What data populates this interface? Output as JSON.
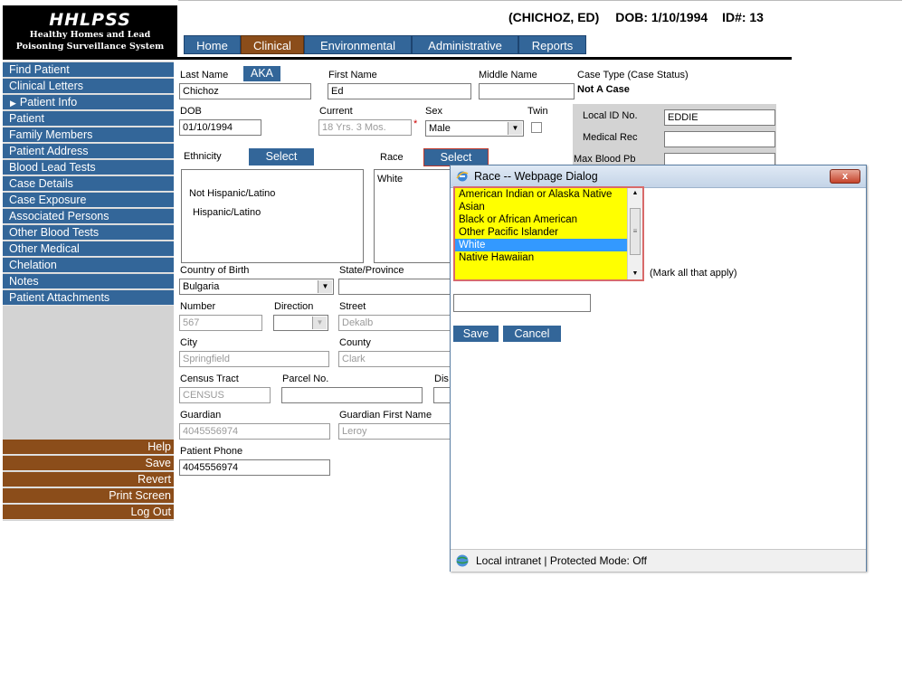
{
  "logo": {
    "title": "HHLPSS",
    "line1": "Healthy Homes and Lead",
    "line2": "Poisoning Surveillance System"
  },
  "patient_header": {
    "name": "(CHICHOZ, ED)",
    "dob": "DOB: 1/10/1994",
    "id": "ID#: 13"
  },
  "tabs": [
    {
      "label": "Home",
      "active": false
    },
    {
      "label": "Clinical",
      "active": true
    },
    {
      "label": "Environmental",
      "active": false
    },
    {
      "label": "Administrative",
      "active": false
    },
    {
      "label": "Reports",
      "active": false
    }
  ],
  "sidebar": {
    "nav": [
      "Find Patient",
      "Clinical Letters",
      "Patient Info",
      "Patient",
      "Family Members",
      "Patient Address",
      "Blood Lead Tests",
      "Case Details",
      "Case Exposure",
      "Associated Persons",
      "Other Blood Tests",
      "Other Medical",
      "Chelation",
      "Notes",
      "Patient Attachments"
    ],
    "current_item": "Patient Info",
    "actions": [
      "Help",
      "Save",
      "Revert",
      "Print Screen",
      "Log Out"
    ]
  },
  "form": {
    "last_name": {
      "label": "Last Name",
      "value": "Chichoz"
    },
    "aka_button": "AKA",
    "first_name": {
      "label": "First Name",
      "value": "Ed"
    },
    "middle_name": {
      "label": "Middle Name",
      "value": ""
    },
    "case_type": {
      "label": "Case Type (Case Status)",
      "value": "Not A Case"
    },
    "dob": {
      "label": "DOB",
      "value": "01/10/1994"
    },
    "current_age": {
      "label": "Current",
      "value": "18 Yrs. 3 Mos.",
      "required_mark": "*"
    },
    "sex": {
      "label": "Sex",
      "value": "Male"
    },
    "twin": {
      "label": "Twin",
      "checked": false
    },
    "local_id": {
      "label": "Local ID No.",
      "value": "EDDIE"
    },
    "medical_rec": {
      "label": "Medical Rec",
      "value": ""
    },
    "max_blood_pb": {
      "label": "Max Blood Pb",
      "value": ""
    },
    "ethnicity": {
      "label": "Ethnicity",
      "button": "Select",
      "options": [
        "Not Hispanic/Latino",
        "Hispanic/Latino"
      ]
    },
    "race": {
      "label": "Race",
      "button": "Select",
      "value": "White"
    },
    "country_of_birth": {
      "label": "Country of Birth",
      "value": "Bulgaria"
    },
    "state_province": {
      "label": "State/Province",
      "value": ""
    },
    "number": {
      "label": "Number",
      "value": "567"
    },
    "direction": {
      "label": "Direction",
      "value": ""
    },
    "street": {
      "label": "Street",
      "value": "Dekalb"
    },
    "city": {
      "label": "City",
      "value": "Springfield"
    },
    "county": {
      "label": "County",
      "value": "Clark"
    },
    "census_tract": {
      "label": "Census Tract",
      "value": "CENSUS"
    },
    "parcel_no": {
      "label": "Parcel No.",
      "value": ""
    },
    "district": {
      "label": "Dis"
    },
    "guardian": {
      "label": "Guardian",
      "value": "4045556974"
    },
    "guardian_first_name": {
      "label": "Guardian First Name",
      "value": "Leroy"
    },
    "patient_phone": {
      "label": "Patient Phone",
      "value": "4045556974"
    }
  },
  "dialog": {
    "title": "Race -- Webpage Dialog",
    "close": "x",
    "options": [
      {
        "label": "American Indian or Alaska Native",
        "selected": false
      },
      {
        "label": "Asian",
        "selected": false
      },
      {
        "label": "Black or African American",
        "selected": false
      },
      {
        "label": "Other Pacific Islander",
        "selected": false
      },
      {
        "label": "White",
        "selected": true
      },
      {
        "label": "Native Hawaiian",
        "selected": false
      }
    ],
    "hint": "(Mark all that apply)",
    "text_value": "",
    "save": "Save",
    "cancel": "Cancel",
    "status": "Local intranet | Protected Mode: Off"
  },
  "colors": {
    "nav_blue": "#336699",
    "nav_brown": "#8b4d1a",
    "selection_yellow": "#ffff00",
    "selected_row": "#3399ff"
  }
}
